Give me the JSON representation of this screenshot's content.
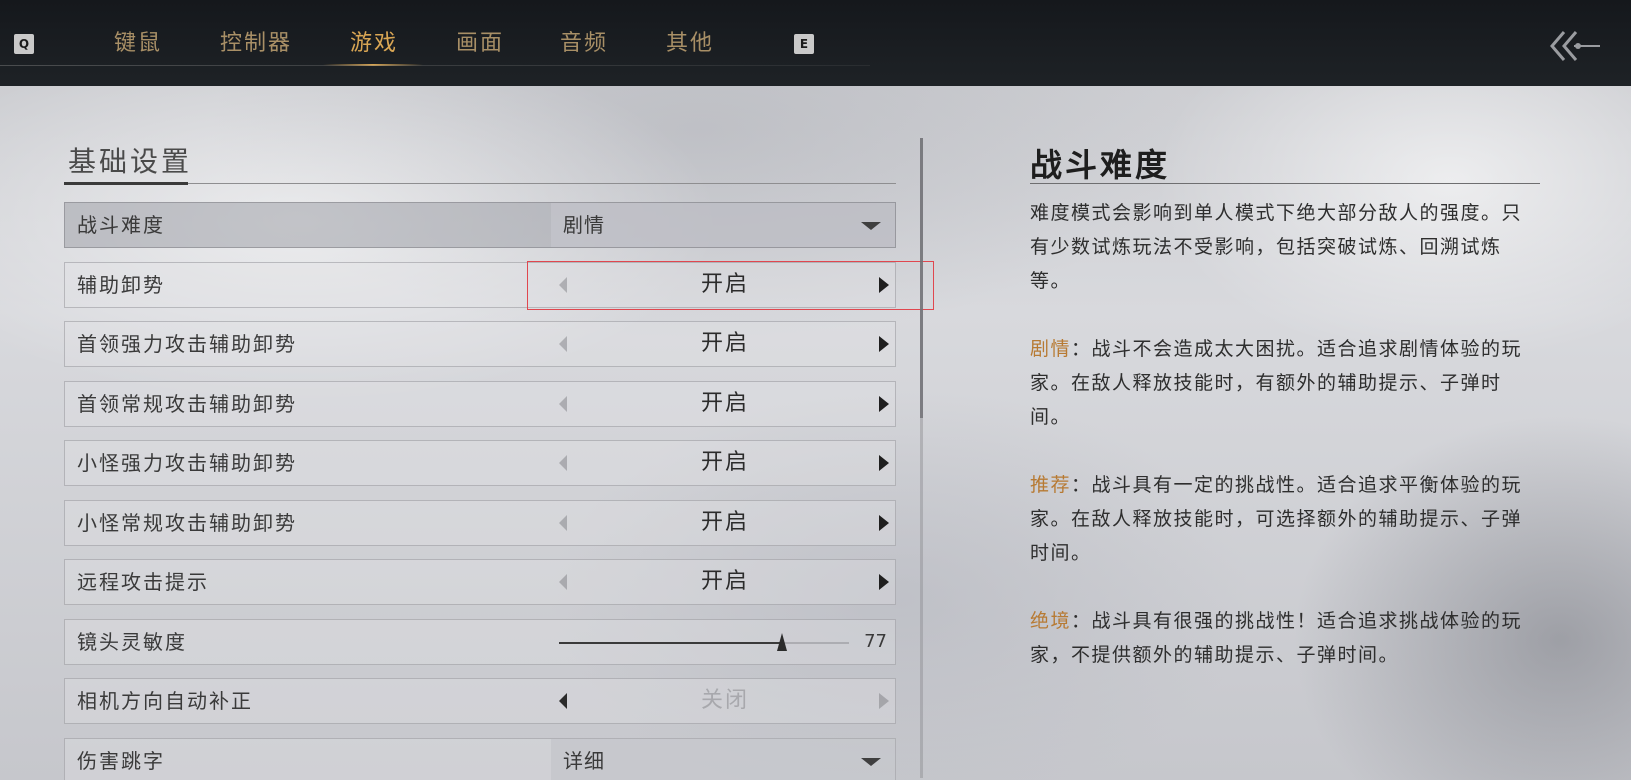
{
  "tabs": {
    "left_key": "Q",
    "right_key": "E",
    "items": [
      {
        "label": "键鼠"
      },
      {
        "label": "控制器"
      },
      {
        "label": "游戏"
      },
      {
        "label": "画面"
      },
      {
        "label": "音频"
      },
      {
        "label": "其他"
      }
    ],
    "active": "游戏"
  },
  "section": {
    "title": "基础设置"
  },
  "settings": [
    {
      "label": "战斗难度",
      "type": "dropdown",
      "value": "剧情"
    },
    {
      "label": "辅助卸势",
      "type": "toggle",
      "value": "开启"
    },
    {
      "label": "首领强力攻击辅助卸势",
      "type": "toggle",
      "value": "开启"
    },
    {
      "label": "首领常规攻击辅助卸势",
      "type": "toggle",
      "value": "开启"
    },
    {
      "label": "小怪强力攻击辅助卸势",
      "type": "toggle",
      "value": "开启"
    },
    {
      "label": "小怪常规攻击辅助卸势",
      "type": "toggle",
      "value": "开启"
    },
    {
      "label": "远程攻击提示",
      "type": "toggle",
      "value": "开启"
    },
    {
      "label": "镜头灵敏度",
      "type": "slider",
      "value": "77",
      "level": 0.77
    },
    {
      "label": "相机方向自动补正",
      "type": "toggle",
      "value": "关闭"
    },
    {
      "label": "伤害跳字",
      "type": "dropdown",
      "value": "详细"
    }
  ],
  "description": {
    "title": "战斗难度",
    "intro": "难度模式会影响到单人模式下绝大部分敌人的强度。只有少数试炼玩法不受影响，包括突破试炼、回溯试炼等。",
    "modes": [
      {
        "keyword": "剧情",
        "text": "：战斗不会造成太大困扰。适合追求剧情体验的玩家。在敌人释放技能时，有额外的辅助提示、子弹时间。"
      },
      {
        "keyword": "推荐",
        "text": "：战斗具有一定的挑战性。适合追求平衡体验的玩家。在敌人释放技能时，可选择额外的辅助提示、子弹时间。"
      },
      {
        "keyword": "绝境",
        "text": "：战斗具有很强的挑战性！适合追求挑战体验的玩家，不提供额外的辅助提示、子弹时间。"
      }
    ]
  },
  "colors": {
    "accent_gold": "#d9a654",
    "tab_inactive": "#a88f66",
    "keyword": "#b77a33",
    "focus_outline": "#e0474f",
    "topbar": "#1a1d21"
  },
  "icons": {
    "back": "double-chevron-left-icon",
    "dropdown": "caret-down-icon",
    "prev": "arrow-left-icon",
    "next": "arrow-right-icon"
  }
}
